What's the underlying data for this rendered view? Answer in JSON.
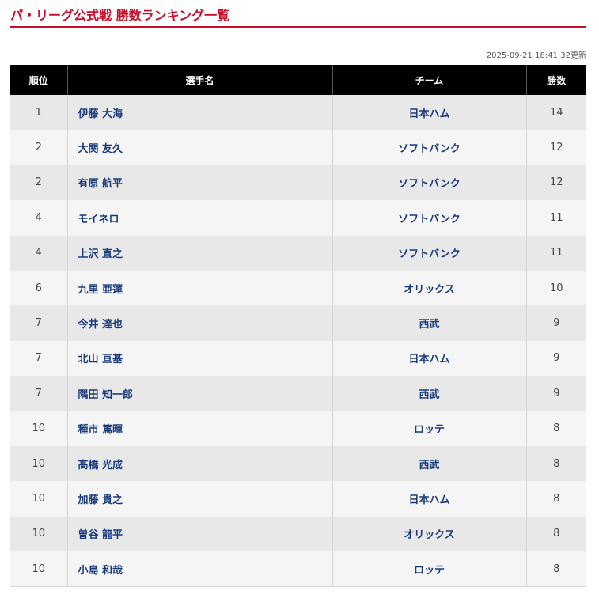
{
  "page": {
    "title": "パ・リーグ公式戦 勝数ランキング一覧",
    "updated": "2025-09-21 18:41:32更新"
  },
  "table": {
    "headers": {
      "rank": "順位",
      "player": "選手名",
      "team": "チーム",
      "wins": "勝数"
    },
    "rows": [
      {
        "rank": "1",
        "player": "伊藤 大海",
        "team": "日本ハム",
        "wins": "14"
      },
      {
        "rank": "2",
        "player": "大関 友久",
        "team": "ソフトバンク",
        "wins": "12"
      },
      {
        "rank": "2",
        "player": "有原 航平",
        "team": "ソフトバンク",
        "wins": "12"
      },
      {
        "rank": "4",
        "player": "モイネロ",
        "team": "ソフトバンク",
        "wins": "11"
      },
      {
        "rank": "4",
        "player": "上沢 直之",
        "team": "ソフトバンク",
        "wins": "11"
      },
      {
        "rank": "6",
        "player": "九里 亜蓮",
        "team": "オリックス",
        "wins": "10"
      },
      {
        "rank": "7",
        "player": "今井 達也",
        "team": "西武",
        "wins": "9"
      },
      {
        "rank": "7",
        "player": "北山 亘基",
        "team": "日本ハム",
        "wins": "9"
      },
      {
        "rank": "7",
        "player": "隅田 知一郎",
        "team": "西武",
        "wins": "9"
      },
      {
        "rank": "10",
        "player": "種市 篤暉",
        "team": "ロッテ",
        "wins": "8"
      },
      {
        "rank": "10",
        "player": "髙橋 光成",
        "team": "西武",
        "wins": "8"
      },
      {
        "rank": "10",
        "player": "加藤 貴之",
        "team": "日本ハム",
        "wins": "8"
      },
      {
        "rank": "10",
        "player": "曽谷 龍平",
        "team": "オリックス",
        "wins": "8"
      },
      {
        "rank": "10",
        "player": "小島 和哉",
        "team": "ロッテ",
        "wins": "8"
      }
    ]
  },
  "colors": {
    "accent": "#c8102e",
    "header_bg": "#000000",
    "link": "#1a3a7a",
    "row_odd": "#e8e8e8",
    "row_even": "#f5f5f5"
  }
}
